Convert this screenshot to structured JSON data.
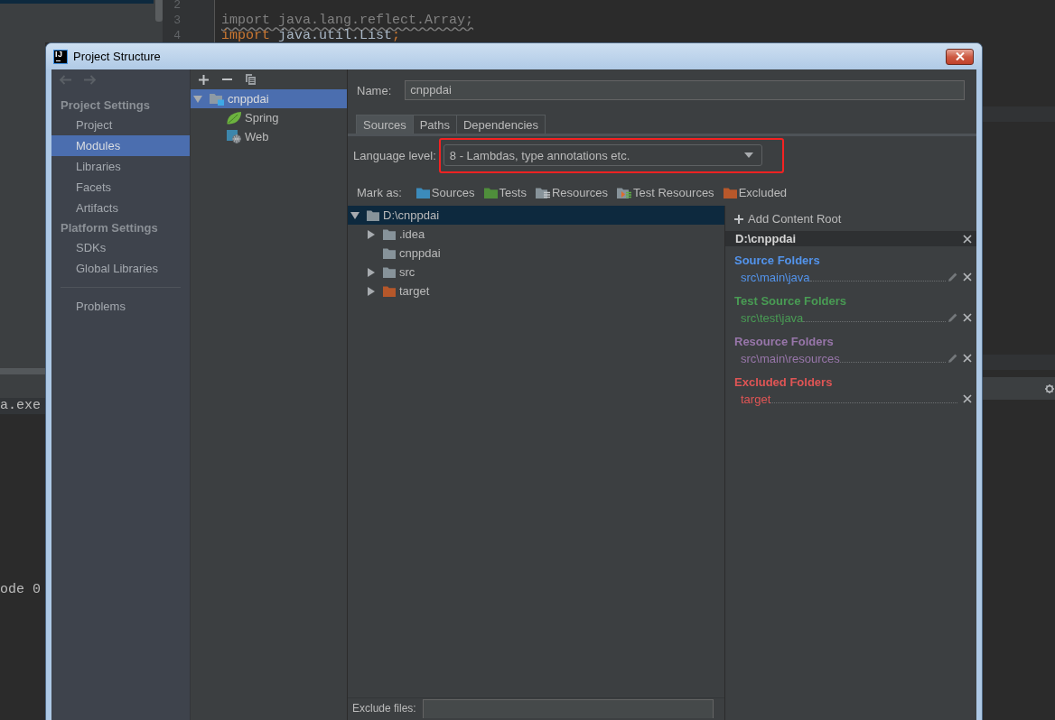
{
  "editor": {
    "lines": [
      {
        "number": "2"
      },
      {
        "number": "3",
        "tokens": [
          {
            "text": "import java.lang.reflect.Array;",
            "kind": "unused"
          }
        ]
      },
      {
        "number": "4",
        "tokens": [
          {
            "text": "import",
            "kind": "keyword"
          },
          {
            "text": " java.util.List",
            "kind": "plain"
          },
          {
            "text": ";",
            "kind": "keyword"
          }
        ]
      }
    ]
  },
  "console": {
    "lines": [
      "a.exe",
      "ode 0"
    ]
  },
  "window": {
    "logo": "IJ",
    "title": "Project Structure"
  },
  "nav_buttons": [
    {
      "kind": "back",
      "disabled": true
    },
    {
      "kind": "forward",
      "disabled": true
    }
  ],
  "sidebar": {
    "sections": [
      {
        "title": "Project Settings",
        "items": [
          {
            "label": "Project",
            "selected": false
          },
          {
            "label": "Modules",
            "selected": true
          },
          {
            "label": "Libraries",
            "selected": false
          },
          {
            "label": "Facets",
            "selected": false
          },
          {
            "label": "Artifacts",
            "selected": false
          }
        ]
      },
      {
        "title": "Platform Settings",
        "items": [
          {
            "label": "SDKs",
            "selected": false
          },
          {
            "label": "Global Libraries",
            "selected": false
          }
        ]
      }
    ],
    "footer_items": [
      {
        "label": "Problems",
        "selected": false
      }
    ]
  },
  "module_toolbar": [
    {
      "kind": "add"
    },
    {
      "kind": "remove"
    },
    {
      "kind": "copy"
    }
  ],
  "module_tree": {
    "items": [
      {
        "label": "cnppdai",
        "kind": "module",
        "selected": true,
        "expanded": true,
        "children": [
          {
            "label": "Spring",
            "kind": "spring",
            "selected": false
          },
          {
            "label": "Web",
            "kind": "web",
            "selected": false
          }
        ]
      }
    ]
  },
  "name_field": {
    "label": "Name:",
    "value": "cnppdai"
  },
  "tabs": [
    {
      "label": "Sources",
      "selected": true
    },
    {
      "label": "Paths",
      "selected": false
    },
    {
      "label": "Dependencies",
      "selected": false
    }
  ],
  "language_level": {
    "label": "Language level:",
    "value": "8 - Lambdas, type annotations etc.",
    "highlighted": true
  },
  "mark_as": {
    "label": "Mark as:",
    "buttons": [
      {
        "label": "Sources",
        "kind": "sources"
      },
      {
        "label": "Tests",
        "kind": "tests"
      },
      {
        "label": "Resources",
        "kind": "resources"
      },
      {
        "label": "Test Resources",
        "kind": "test_resources"
      },
      {
        "label": "Excluded",
        "kind": "excluded"
      }
    ]
  },
  "folder_tree": {
    "items": [
      {
        "label": "D:\\cnppdai",
        "kind": "folder",
        "selected": true,
        "expanded": true,
        "children": [
          {
            "label": ".idea",
            "kind": "folder",
            "selected": false,
            "expanded": false
          },
          {
            "label": "cnppdai",
            "kind": "folder",
            "selected": false
          },
          {
            "label": "src",
            "kind": "folder",
            "selected": false,
            "expanded": false
          },
          {
            "label": "target",
            "kind": "excluded",
            "selected": false,
            "expanded": false
          }
        ]
      }
    ]
  },
  "content_root": {
    "add_label": "Add Content Root",
    "path": "D:\\cnppdai",
    "groups": [
      {
        "title": "Source Folders",
        "color": "#5394ec",
        "folders": [
          {
            "path": "src\\main\\java",
            "editable": true
          }
        ]
      },
      {
        "title": "Test Source Folders",
        "color": "#499c54",
        "folders": [
          {
            "path": "src\\test\\java",
            "editable": true
          }
        ]
      },
      {
        "title": "Resource Folders",
        "color": "#9876aa",
        "folders": [
          {
            "path": "src\\main\\resources",
            "editable": true
          }
        ]
      },
      {
        "title": "Excluded Folders",
        "color": "#e05555",
        "folders": [
          {
            "path": "target",
            "editable": false
          }
        ]
      }
    ]
  },
  "exclude_files": {
    "label": "Exclude files:"
  }
}
